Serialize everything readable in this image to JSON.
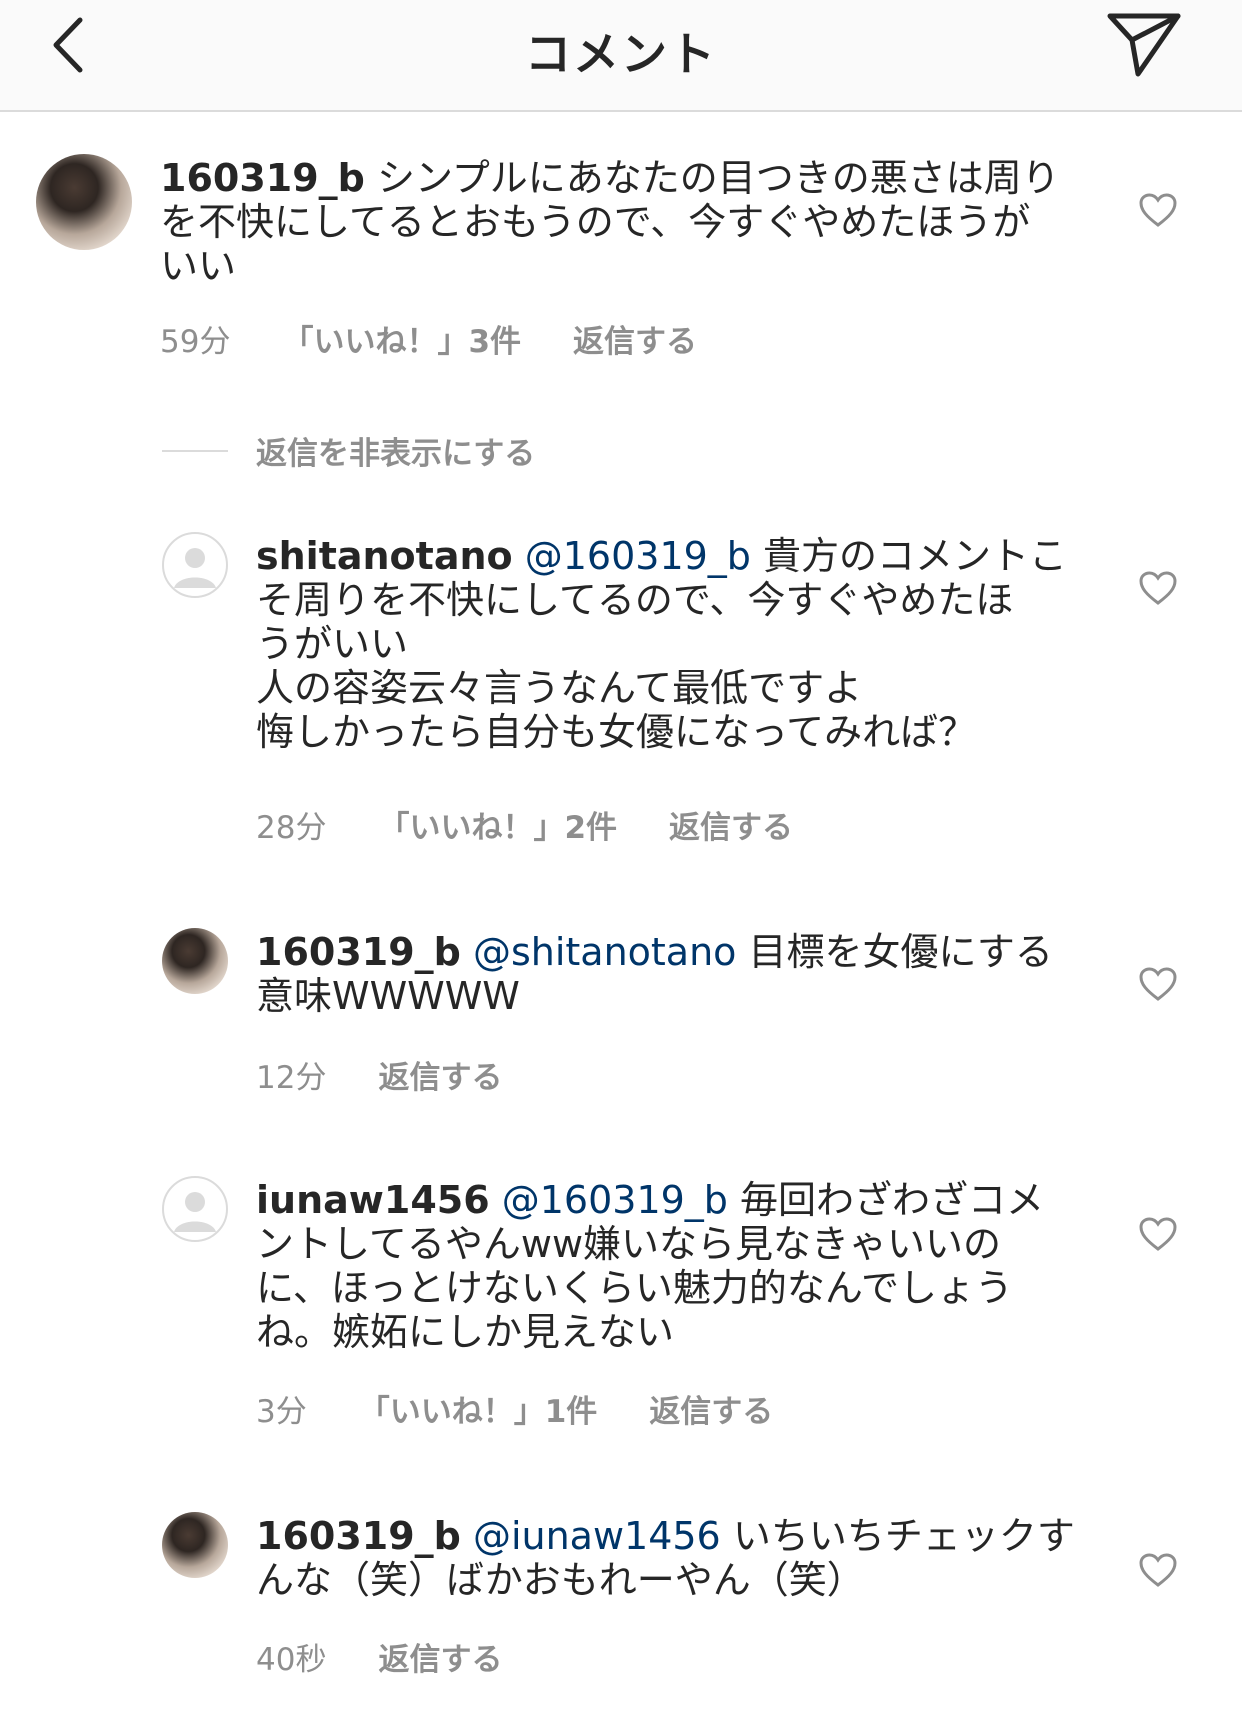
{
  "header": {
    "title": "コメント",
    "back_icon": "chevron-left-icon",
    "send_icon": "paper-plane-icon"
  },
  "hide_replies_label": "返信を非表示にする",
  "comments": [
    {
      "username": "160319_b",
      "mention": "",
      "text": "シンプルにあなたの目つきの悪さは周り\nを不快にしてるとおもうので、今すぐやめたほうが\nいい",
      "time": "59分",
      "likes": "「いいね！」3件",
      "reply": "返信する",
      "avatar": "photo"
    },
    {
      "username": "shitanotano",
      "mention": "@160319_b",
      "text": "貴方のコメントこ\nそ周りを不快にしてるので、今すぐやめたほ\nうがいい\n人の容姿云々言うなんて最低ですよ\n悔しかったら自分も女優になってみれば？",
      "time": "28分",
      "likes": "「いいね！」2件",
      "reply": "返信する",
      "avatar": "default"
    },
    {
      "username": "160319_b",
      "mention": "@shitanotano",
      "text": "目標を女優にする\n意味WWWWW",
      "time": "12分",
      "likes": "",
      "reply": "返信する",
      "avatar": "photo"
    },
    {
      "username": "iunaw1456",
      "mention": "@160319_b",
      "text": "毎回わざわざコメ\nントしてるやんww嫌いなら見なきゃいいの\nに、ほっとけないくらい魅力的なんでしょう\nね。嫉妬にしか見えない",
      "time": "3分",
      "likes": "「いいね！」1件",
      "reply": "返信する",
      "avatar": "default"
    },
    {
      "username": "160319_b",
      "mention": "@iunaw1456",
      "text": "いちいちチェックす\nんな（笑）ばかおもれーやん（笑）",
      "time": "40秒",
      "likes": "",
      "reply": "返信する",
      "avatar": "photo"
    }
  ],
  "colors": {
    "mention": "#003569",
    "meta": "#8e8e8e",
    "text": "#262626"
  }
}
